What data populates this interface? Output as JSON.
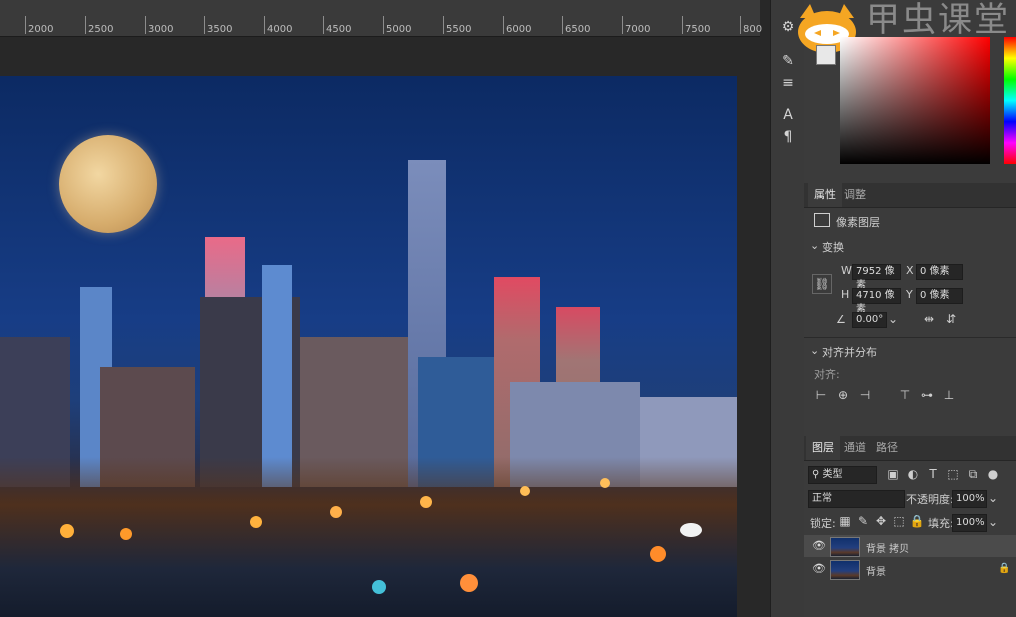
{
  "ruler": {
    "ticks": [
      "2000",
      "2500",
      "3000",
      "3500",
      "4000",
      "4500",
      "5000",
      "5500",
      "6000",
      "6500",
      "7000",
      "7500",
      "800"
    ]
  },
  "watermark": {
    "text": "甲虫课堂"
  },
  "icons": {
    "strip": [
      "brush-settings-icon",
      "brush-icon",
      "adjust-icon",
      "character-icon",
      "paragraph-icon"
    ]
  },
  "properties": {
    "tabs": [
      "属性",
      "调整"
    ],
    "layer_type": "像素图层",
    "transform_title": "变换",
    "w_label": "W",
    "w_value": "7952 像素",
    "h_label": "H",
    "h_value": "4710 像素",
    "x_label": "X",
    "x_value": "0 像素",
    "y_label": "Y",
    "y_value": "0 像素",
    "angle_value": "0.00°",
    "align_title": "对齐并分布",
    "align_label": "对齐:"
  },
  "layers": {
    "tabs": [
      "图层",
      "通道",
      "路径"
    ],
    "filter_value": "类型",
    "blend_mode": "正常",
    "opacity_label": "不透明度:",
    "opacity_value": "100%",
    "lock_label": "锁定:",
    "fill_label": "填充:",
    "fill_value": "100%",
    "items": [
      {
        "name": "背景 拷贝",
        "selected": true
      },
      {
        "name": "背景",
        "locked": true
      }
    ]
  },
  "colors": {
    "panel_bg": "#3b3b3b",
    "selected_layer": "#4b4b4b"
  }
}
